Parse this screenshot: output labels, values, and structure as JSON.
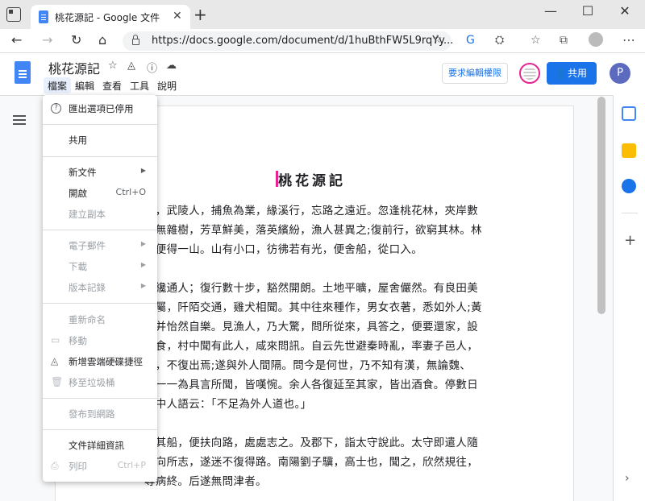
{
  "browser": {
    "tab_title": "桃花源記 - Google 文件",
    "tab_close": "✕",
    "new_tab": "+",
    "url": "https://docs.google.com/document/d/1huBthFW5L9rqYy...",
    "minimize": "—",
    "maximize": "☐",
    "close": "✕",
    "back": "←",
    "forward": "→",
    "reload": "↻",
    "home": "⌂"
  },
  "doc": {
    "title": "桃花源記",
    "menu": [
      "檔案",
      "編輯",
      "查看",
      "工具",
      "說明"
    ],
    "request_edit": "要求編輯權限",
    "share_label": "共用",
    "profile_initial": "P"
  },
  "content": {
    "heading": "桃花源記",
    "lines": [
      "中，武陵人，捕魚為業，緣溪行，忘路之遠近。忽逢桃花林，夾岸數",
      "中無雜樹，芳草鮮美，落英繽紛，漁人甚異之;復前行，欲窮其林。林",
      "，便得一山。山有小口，彷彿若有光，便舍船，從口入。",
      "",
      "，纔通人；復行數十步，豁然開朗。土地平曠，屋舍儼然。有良田美",
      "之屬，阡陌交通，雞犬相聞。其中往來種作，男女衣著，悉如外人;黃",
      "，并怡然自樂。見漁人，乃大驚，問所從來，具答之，便要還家，設",
      "作食，村中聞有此人，咸來問訊。自云先世避秦時亂，率妻子邑人，",
      "境，不復出焉;遂與外人間隔。問今是何世，乃不知有漢，無論魏、",
      "人一一為具言所聞，皆嘆惋。余人各復延至其家，皆出酒食。停數日",
      "此中人語云：「不足為外人道也。」",
      "",
      "得其船，便扶向路，處處志之。及郡下，詣太守說此。太守即遣人隨",
      "尋向所志，遂迷不復得路。南陽劉子驥，高士也，聞之，欣然規往，",
      "尋病終。后遂無問津者。"
    ]
  },
  "file_menu": {
    "items": [
      {
        "label": "匯出選項已停用",
        "icon": "?",
        "disabled": false
      },
      {
        "label": "共用",
        "disabled": false
      },
      {
        "label": "新文件",
        "arrow": "▶",
        "disabled": false
      },
      {
        "label": "開啟",
        "shortcut": "Ctrl+O",
        "disabled": false
      },
      {
        "label": "建立副本",
        "disabled": true
      },
      {
        "label": "電子郵件",
        "arrow": "▶",
        "disabled": true
      },
      {
        "label": "下載",
        "arrow": "▶",
        "disabled": true
      },
      {
        "label": "版本記錄",
        "arrow": "▶",
        "disabled": true
      },
      {
        "label": "重新命名",
        "disabled": true
      },
      {
        "label": "移動",
        "icon": "▭",
        "disabled": true
      },
      {
        "label": "新增雲端硬碟捷徑",
        "icon": "◬",
        "disabled": false
      },
      {
        "label": "移至垃圾桶",
        "icon": "🗑",
        "disabled": true
      },
      {
        "label": "發布到網路",
        "disabled": true
      },
      {
        "label": "文件詳細資訊",
        "disabled": false
      },
      {
        "label": "列印",
        "icon": "⎙",
        "shortcut": "Ctrl+P",
        "disabled": true
      }
    ]
  },
  "colors": {
    "accent": "#1a73e8",
    "docs_blue": "#4285f4",
    "profile": "#5c6bc0"
  }
}
